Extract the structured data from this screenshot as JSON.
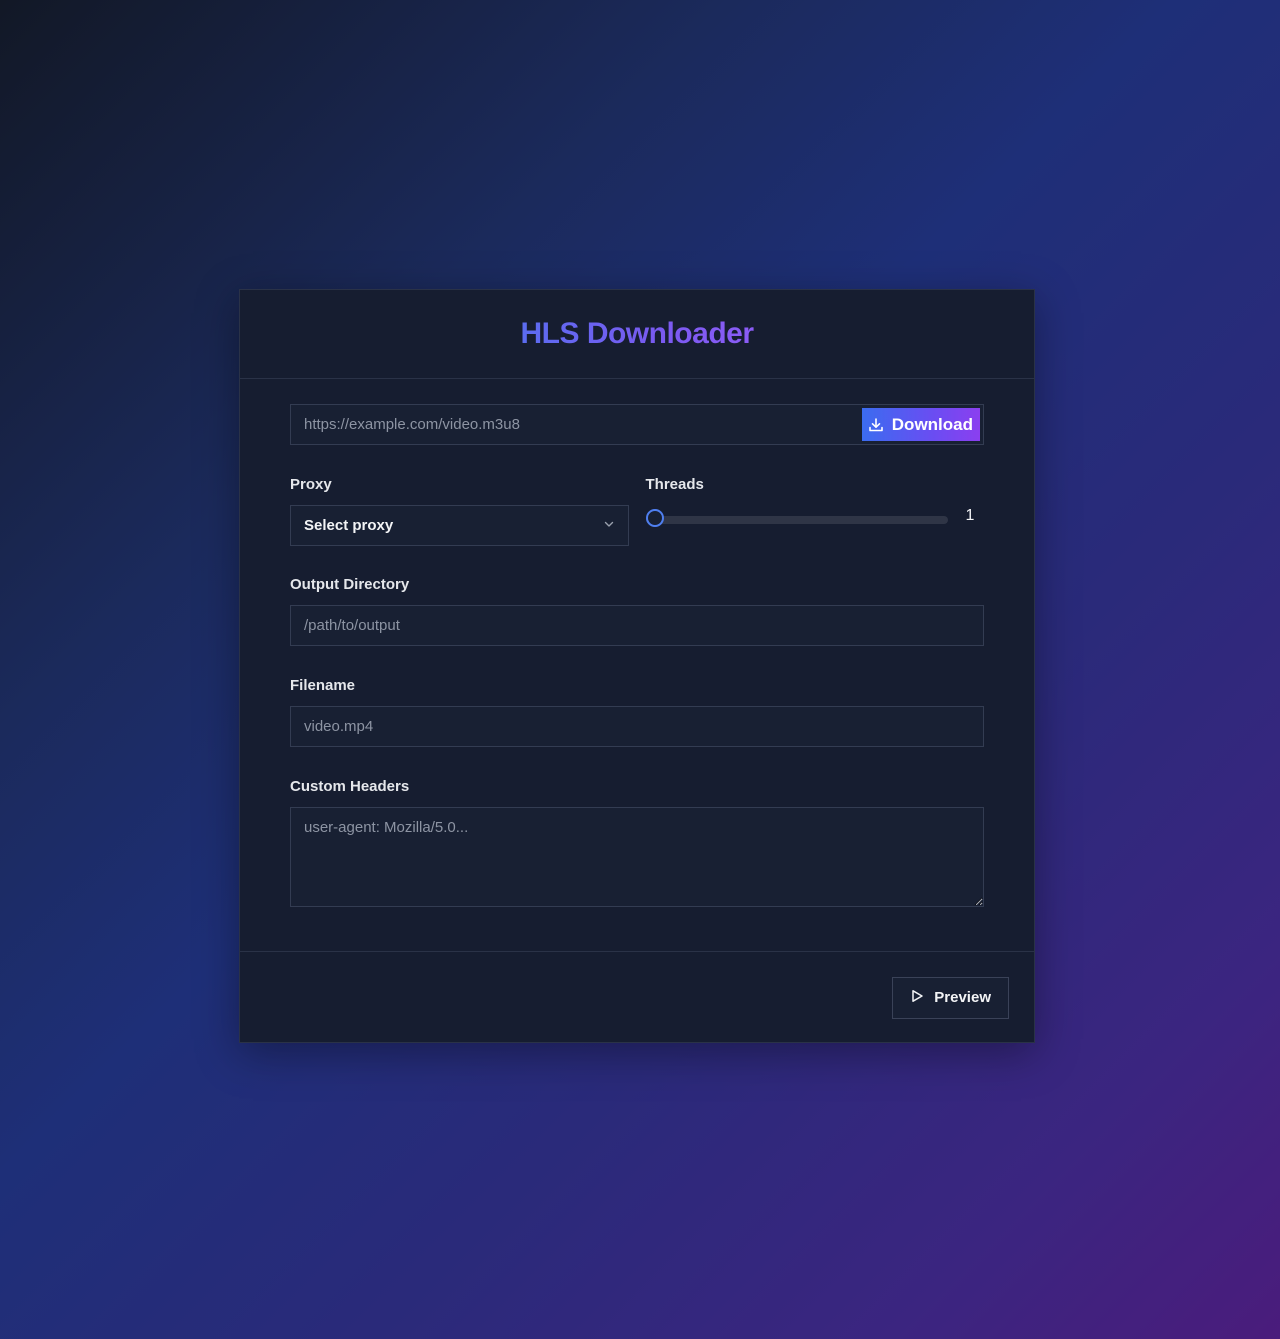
{
  "app": {
    "title": "HLS Downloader"
  },
  "url": {
    "value": "",
    "placeholder": "https://example.com/video.m3u8",
    "download_label": "Download",
    "download_icon": "download-icon"
  },
  "proxy": {
    "label": "Proxy",
    "selected": "Select proxy",
    "icon": "chevron-down-icon"
  },
  "threads": {
    "label": "Threads",
    "value": "1",
    "level_fraction": 0
  },
  "output_directory": {
    "label": "Output Directory",
    "value": "",
    "placeholder": "/path/to/output"
  },
  "filename": {
    "label": "Filename",
    "value": "",
    "placeholder": "video.mp4"
  },
  "custom_headers": {
    "label": "Custom Headers",
    "value": "",
    "placeholder": "user-agent: Mozilla/5.0..."
  },
  "footer": {
    "preview_label": "Preview",
    "preview_icon": "play-icon"
  },
  "colors": {
    "accent_start": "#3b6cf0",
    "accent_end": "#8b3ff0",
    "title_gradient_start": "#5b6cf0",
    "title_gradient_end": "#8b5cf6",
    "card_bg": "#161d30",
    "input_bg": "#182033",
    "slider_thumb": "#4f7ff0"
  }
}
